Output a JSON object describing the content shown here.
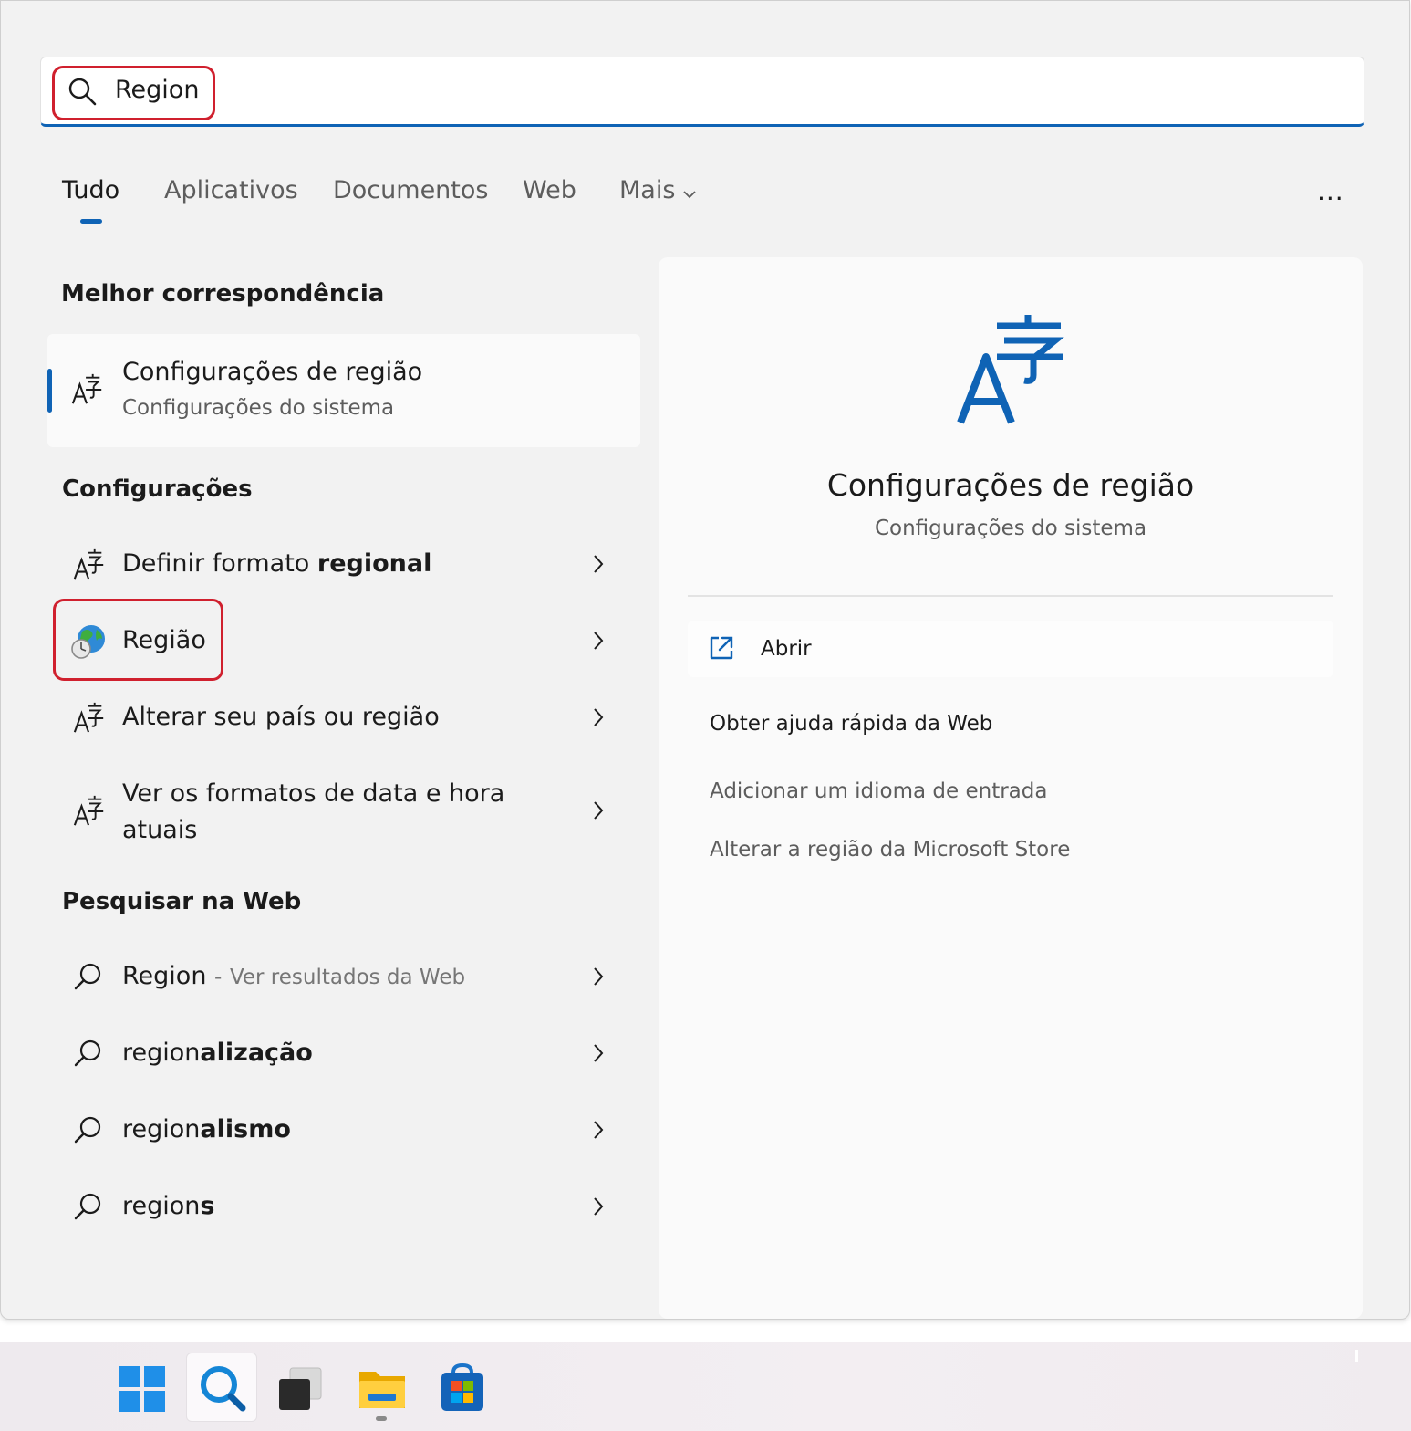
{
  "search": {
    "value": "Region"
  },
  "tabs": [
    {
      "label": "Tudo"
    },
    {
      "label": "Aplicativos"
    },
    {
      "label": "Documentos"
    },
    {
      "label": "Web"
    },
    {
      "label": "Mais"
    }
  ],
  "more_label": "...",
  "best_match": {
    "heading": "Melhor correspondência",
    "title": "Configurações de região",
    "subtitle": "Configurações do sistema"
  },
  "settings": {
    "heading": "Configurações",
    "items": [
      {
        "label_pre": "Definir formato ",
        "label_bold": "regional",
        "label_post": ""
      },
      {
        "label": "Região"
      },
      {
        "label": "Alterar seu país ou região"
      },
      {
        "line1": "Ver os formatos de data e hora",
        "line2": "atuais"
      }
    ]
  },
  "web": {
    "heading": "Pesquisar na Web",
    "items": [
      {
        "label": "Region",
        "suffix": "Ver resultados da Web",
        "separator": "-"
      },
      {
        "prefix": "region",
        "bold": "alização"
      },
      {
        "prefix": "region",
        "bold": "alismo"
      },
      {
        "prefix": "region",
        "bold": "s"
      }
    ]
  },
  "details": {
    "title": "Configurações de região",
    "subtitle": "Configurações do sistema",
    "open_label": "Abrir",
    "quick_help": "Obter ajuda rápida da Web",
    "links": [
      "Adicionar um idioma de entrada",
      "Alterar a região da Microsoft Store"
    ]
  },
  "colors": {
    "accent": "#0f63b5",
    "highlight": "#d0202e",
    "panel": "#f2f2f2"
  },
  "icons": {
    "search": "search-icon",
    "language": "language-settings-icon",
    "region": "globe-clock-icon",
    "open": "open-external-icon",
    "chevron": "chevron-right-icon"
  }
}
